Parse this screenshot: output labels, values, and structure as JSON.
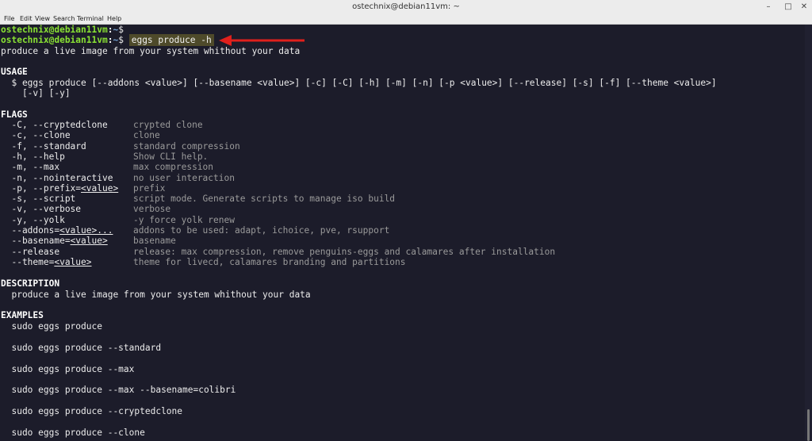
{
  "window": {
    "title": "ostechnix@debian11vm: ~",
    "minimize": "–",
    "maximize": "□",
    "close": "✕"
  },
  "menu": [
    "File",
    "Edit",
    "View",
    "Search",
    "Terminal",
    "Help"
  ],
  "prompt": {
    "user": "ostechnix@debian11vm",
    "path": "~",
    "symbol": "$",
    "command": "eggs produce -h"
  },
  "summary": "produce a live image from your system whithout your data",
  "usage": {
    "heading": "USAGE",
    "line1": "  $ eggs produce [--addons <value>] [--basename <value>] [-c] [-C] [-h] [-m] [-n] [-p <value>] [--release] [-s] [-f] [--theme <value>]",
    "line2": "    [-v] [-y]"
  },
  "flags": {
    "heading": "FLAGS",
    "rows": [
      {
        "flag": "  -C, --cryptedclone",
        "desc": "crypted clone"
      },
      {
        "flag": "  -c, --clone",
        "desc": "clone"
      },
      {
        "flag": "  -f, --standard",
        "desc": "standard compression"
      },
      {
        "flag": "  -h, --help",
        "desc": "Show CLI help."
      },
      {
        "flag": "  -m, --max",
        "desc": "max compression"
      },
      {
        "flag": "  -n, --nointeractive",
        "desc": "no user interaction"
      },
      {
        "flag": "  -p, --prefix=",
        "flag_arg": "<value>",
        "desc": "prefix"
      },
      {
        "flag": "  -s, --script",
        "desc": "script mode. Generate scripts to manage iso build"
      },
      {
        "flag": "  -v, --verbose",
        "desc": "verbose"
      },
      {
        "flag": "  -y, --yolk",
        "desc": "-y force yolk renew"
      },
      {
        "flag": "  --addons=",
        "flag_arg": "<value>...",
        "desc": "addons to be used: adapt, ichoice, pve, rsupport"
      },
      {
        "flag": "  --basename=",
        "flag_arg": "<value>",
        "desc": "basename"
      },
      {
        "flag": "  --release",
        "desc": "release: max compression, remove penguins-eggs and calamares after installation"
      },
      {
        "flag": "  --theme=",
        "flag_arg": "<value>",
        "desc": "theme for livecd, calamares branding and partitions"
      }
    ]
  },
  "description": {
    "heading": "DESCRIPTION",
    "text": "  produce a live image from your system whithout your data"
  },
  "examples": {
    "heading": "EXAMPLES",
    "items": [
      "  sudo eggs produce",
      "  sudo eggs produce --standard",
      "  sudo eggs produce --max",
      "  sudo eggs produce --max --basename=colibri",
      "  sudo eggs produce --cryptedclone",
      "  sudo eggs produce --clone"
    ]
  },
  "colors": {
    "background": "#1c1c2a",
    "prompt_user": "#8ae234",
    "prompt_path": "#729fcf",
    "annotation_arrow": "#e0201c"
  },
  "annotation": "red-arrow-icon"
}
